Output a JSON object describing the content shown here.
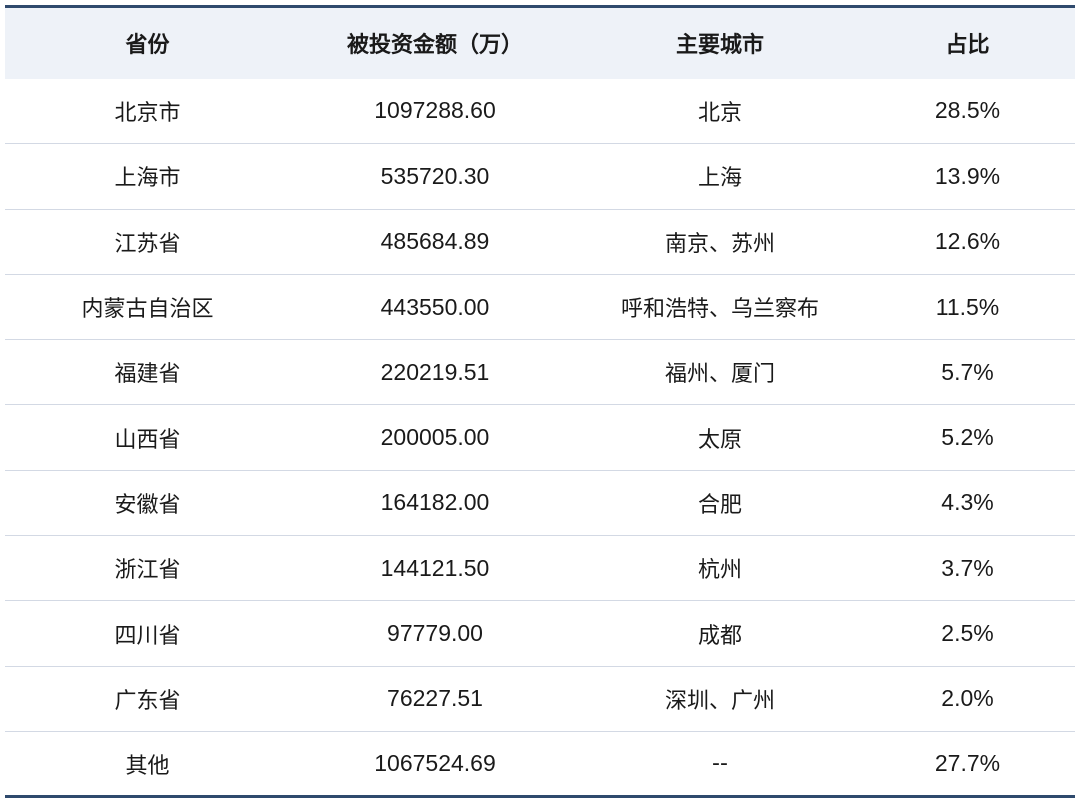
{
  "table": {
    "headers": [
      "省份",
      "被投资金额（万）",
      "主要城市",
      "占比"
    ],
    "rows": [
      {
        "province": "北京市",
        "amount": "1097288.60",
        "cities": "北京",
        "share": "28.5%"
      },
      {
        "province": "上海市",
        "amount": "535720.30",
        "cities": "上海",
        "share": "13.9%"
      },
      {
        "province": "江苏省",
        "amount": "485684.89",
        "cities": "南京、苏州",
        "share": "12.6%"
      },
      {
        "province": "内蒙古自治区",
        "amount": "443550.00",
        "cities": "呼和浩特、乌兰察布",
        "share": "11.5%"
      },
      {
        "province": "福建省",
        "amount": "220219.51",
        "cities": "福州、厦门",
        "share": "5.7%"
      },
      {
        "province": "山西省",
        "amount": "200005.00",
        "cities": "太原",
        "share": "5.2%"
      },
      {
        "province": "安徽省",
        "amount": "164182.00",
        "cities": "合肥",
        "share": "4.3%"
      },
      {
        "province": "浙江省",
        "amount": "144121.50",
        "cities": "杭州",
        "share": "3.7%"
      },
      {
        "province": "四川省",
        "amount": "97779.00",
        "cities": "成都",
        "share": "2.5%"
      },
      {
        "province": "广东省",
        "amount": "76227.51",
        "cities": "深圳、广州",
        "share": "2.0%"
      },
      {
        "province": "其他",
        "amount": "1067524.69",
        "cities": "--",
        "share": "27.7%"
      }
    ]
  },
  "colors": {
    "header_bg": "#eef2f8",
    "rule": "#2f4a6d",
    "row_divider": "#d3d9e4"
  }
}
